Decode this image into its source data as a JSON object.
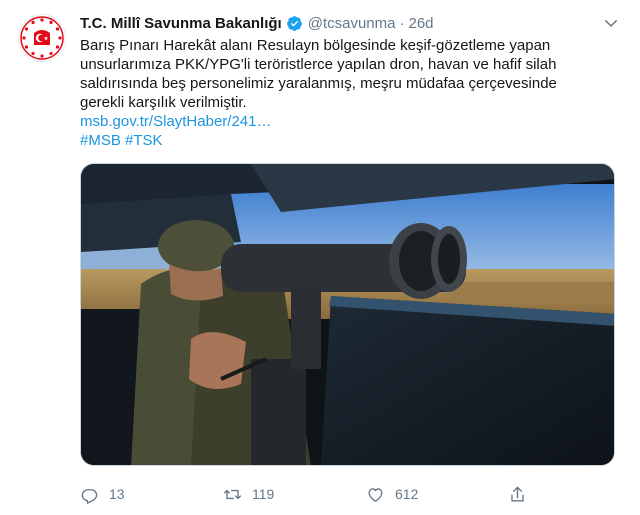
{
  "tweet": {
    "display_name": "T.C. Millî Savunma Bakanlığı",
    "handle": "@tcsavunma",
    "separator": "·",
    "time": "26d",
    "text_lines": [
      "Barış Pınarı Harekât alanı Resulayn bölgesinde keşif-gözetleme yapan",
      "unsurlarımıza PKK/YPG'li teröristlerce yapılan dron, havan ve hafif silah",
      "saldırısında beş personelimiz yaralanmış, meşru müdafaa çerçevesinde",
      "gerekli karşılık verilmiştir."
    ],
    "link": "msb.gov.tr/SlaytHaber/241…",
    "hashtags": "#MSB #TSK"
  },
  "actions": {
    "reply_count": "13",
    "retweet_count": "119",
    "like_count": "612"
  },
  "icons": {
    "avatar": "ministry-emblem-icon",
    "verified": "verified-badge-icon",
    "menu": "chevron-down-icon",
    "reply": "reply-icon",
    "retweet": "retweet-icon",
    "like": "heart-icon",
    "share": "share-icon"
  },
  "colors": {
    "accent": "#1b95e0",
    "muted": "#657786",
    "emblem_red": "#e30a17"
  }
}
